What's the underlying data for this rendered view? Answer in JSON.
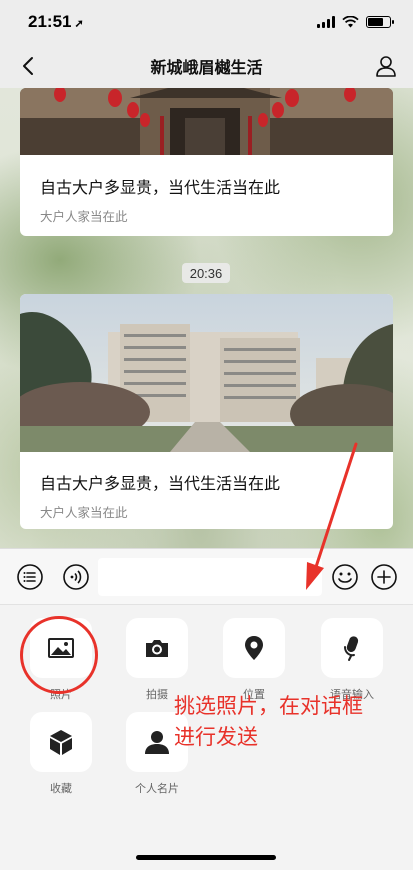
{
  "status_bar": {
    "time": "21:51",
    "location_glyph": "➚"
  },
  "header": {
    "title": "新城峨眉樾生活"
  },
  "messages": [
    {
      "title": "自古大户多显贵，当代生活当在此",
      "subtitle": "大户人家当在此"
    },
    {
      "title": "自古大户多显贵，当代生活当在此",
      "subtitle": "大户人家当在此"
    }
  ],
  "timestamp": "20:36",
  "input": {
    "value": "",
    "placeholder": ""
  },
  "tools": [
    {
      "label": "照片",
      "icon": "image-icon"
    },
    {
      "label": "拍摄",
      "icon": "camera-icon"
    },
    {
      "label": "位置",
      "icon": "location-pin-icon"
    },
    {
      "label": "语音输入",
      "icon": "microphone-icon"
    },
    {
      "label": "收藏",
      "icon": "cube-icon"
    },
    {
      "label": "个人名片",
      "icon": "person-icon"
    }
  ],
  "annotation": {
    "line1": "挑选照片，在对话框",
    "line2": "进行发送",
    "color": "#e8322a"
  },
  "colors": {
    "bar_bg": "#ededed",
    "panel_bg": "#f3f3f3",
    "accent_red": "#e8322a"
  }
}
